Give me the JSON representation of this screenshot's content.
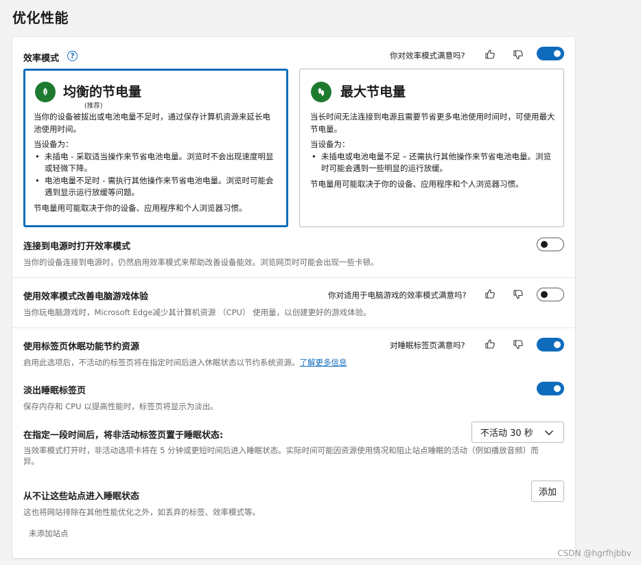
{
  "page": {
    "title": "优化性能"
  },
  "efficiency": {
    "label": "效率模式",
    "help_icon": "?",
    "feedback_question": "你对效率模式满意吗?",
    "toggle_on": true
  },
  "modes": [
    {
      "title": "均衡的节电量",
      "subtitle": "(推荐)",
      "icon": "leaf-icon",
      "selected": true,
      "intro": "当你的设备被拔出或电池电量不足时，通过保存计算机资源来延长电池使用时间。",
      "when_label": "当设备为：",
      "bullets": [
        "未插电 - 采取适当操作来节省电池电量。浏览时不会出现速度明显或轻微下降。",
        "电池电量不足时 - 需执行其他操作来节省电池电量。浏览时可能会遇到显示运行放缓等问题。"
      ],
      "note": "节电量用可能取决于你的设备、应用程序和个人浏览器习惯。"
    },
    {
      "title": "最大节电量",
      "icon": "double-leaf-icon",
      "selected": false,
      "intro": "当长时间无法连接到电源且需要节省更多电池使用时间时，可使用最大节电量。",
      "when_label": "当设备为：",
      "bullets": [
        "未插电或电池电量不足 – 还需执行其他操作来节省电池电量。浏览时可能会遇到一些明显的运行放缓。"
      ],
      "note": "节电量用可能取决于你的设备、应用程序和个人浏览器习惯。"
    }
  ],
  "power_connected": {
    "label": "连接到电源时打开效率模式",
    "desc": "当你的设备连接到电源时，仍然启用效率模式来帮助改善设备能效。浏览网页时可能会出现一些卡顿。",
    "toggle_on": false
  },
  "gaming": {
    "label": "使用效率模式改善电脑游戏体验",
    "feedback_question": "你对适用于电脑游戏的效率模式满意吗?",
    "desc": "当你玩电脑游戏时，Microsoft Edge减少其计算机资源 （CPU） 使用量，以创建更好的游戏体验。",
    "toggle_on": false
  },
  "sleeping_tabs": {
    "label": "使用标签页休眠功能节约资源",
    "feedback_question": "对睡眠标签页满意吗?",
    "desc": "启用此选项后，不活动的标签页将在指定时间后进入休眠状态以节约系统资源。",
    "link": "了解更多信息",
    "toggle_on": true
  },
  "fade_tabs": {
    "label": "淡出睡眠标签页",
    "desc": "保存内存和 CPU 以提高性能时，标签页将显示为淡出。",
    "toggle_on": true
  },
  "sleep_after": {
    "label": "在指定一段时间后，将非活动标签页置于睡眠状态:",
    "selected": "不活动 30 秒",
    "desc_line1": "当效率模式打开时，非活动选项卡将在 5 分钟或更短时间后进入睡眠状态。实际时间可能因资源使用情况和阻止站点睡眠的活动（例如播放音频）而",
    "desc_line2": "异。"
  },
  "never_sleep": {
    "label": "从不让这些站点进入睡眠状态",
    "add_button": "添加",
    "desc": "这也将网站排除在其他性能优化之外，如丢弃的标签、效率模式等。",
    "empty_text": "未添加站点"
  },
  "watermark": "CSDN @hgrfhjbbv"
}
